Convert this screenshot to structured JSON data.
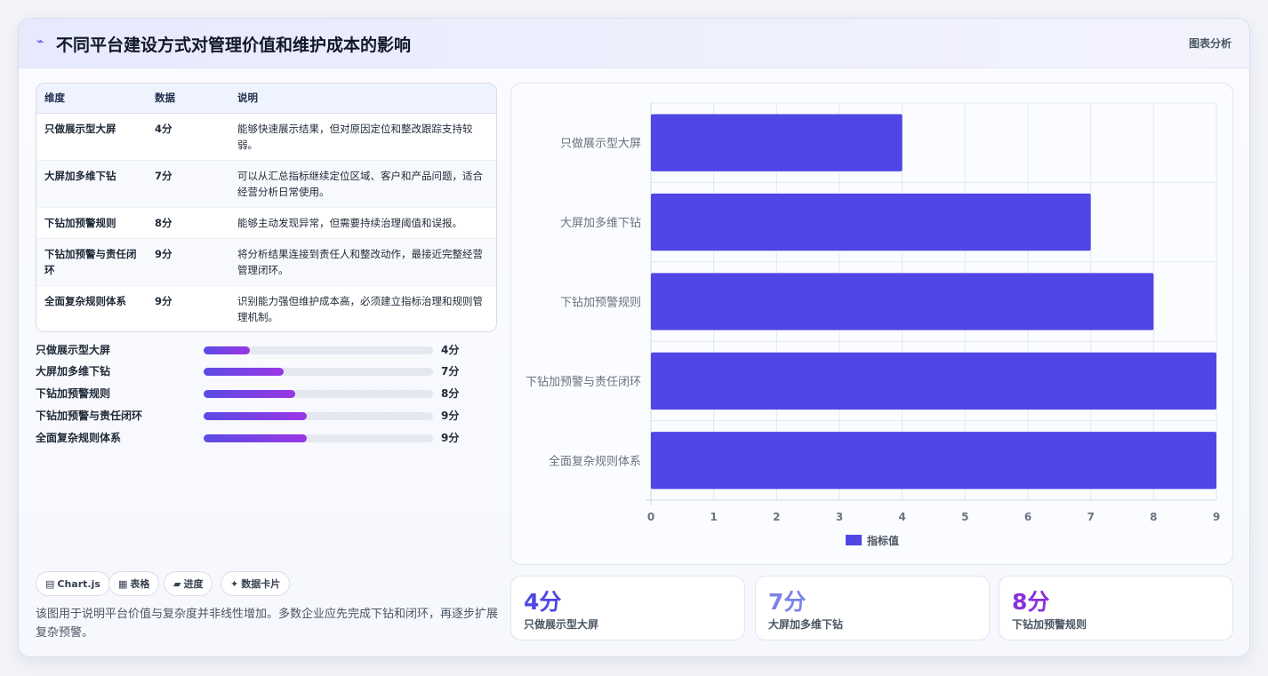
{
  "header": {
    "logo_icon": "pulse-icon",
    "logo_glyph": "⌁",
    "title": "不同平台建设方式对管理价值和维护成本的影响",
    "tag": "图表分析"
  },
  "table": {
    "headers": [
      "维度",
      "数据",
      "说明"
    ],
    "rows": [
      [
        "只做展示型大屏",
        "4分",
        "能够快速展示结果，但对原因定位和整改跟踪支持较弱。"
      ],
      [
        "大屏加多维下钻",
        "7分",
        "可以从汇总指标继续定位区域、客户和产品问题，适合经营分析日常使用。"
      ],
      [
        "下钻加预警规则",
        "8分",
        "能够主动发现异常，但需要持续治理阈值和误报。"
      ],
      [
        "下钻加预警与责任闭环",
        "9分",
        "将分析结果连接到责任人和整改动作，最接近完整经营管理闭环。"
      ],
      [
        "全面复杂规则体系",
        "9分",
        "识别能力强但维护成本高，必须建立指标治理和规则管理机制。"
      ]
    ]
  },
  "progress": [
    {
      "label": "只做展示型大屏",
      "value": 4,
      "display": "4分"
    },
    {
      "label": "大屏加多维下钻",
      "value": 7,
      "display": "7分"
    },
    {
      "label": "下钻加预警规则",
      "value": 8,
      "display": "8分"
    },
    {
      "label": "下钻加预警与责任闭环",
      "value": 9,
      "display": "9分"
    },
    {
      "label": "全面复杂规则体系",
      "value": 9,
      "display": "9分"
    }
  ],
  "progress_max": 20,
  "chips": [
    {
      "icon": "chart-icon",
      "glyph": "▤",
      "label": "Chart.js"
    },
    {
      "icon": "table-icon",
      "glyph": "▦",
      "label": "表格"
    },
    {
      "icon": "folder-icon",
      "glyph": "▰",
      "label": "进度"
    },
    {
      "icon": "sparkle-icon",
      "glyph": "✦",
      "label": "数据卡片"
    }
  ],
  "note": "该图用于说明平台价值与复杂度并非线性增加。多数企业应先完成下钻和闭环，再逐步扩展复杂预警。",
  "stats": [
    {
      "value": "4分",
      "label": "只做展示型大屏",
      "color": "#4f46e5"
    },
    {
      "value": "7分",
      "label": "大屏加多维下钻",
      "color": "#7c83e8"
    },
    {
      "value": "8分",
      "label": "下钻加预警规则",
      "color": "#8b2fd6"
    }
  ],
  "chart_data": {
    "type": "bar",
    "orientation": "horizontal",
    "categories": [
      "只做展示型大屏",
      "大屏加多维下钻",
      "下钻加预警规则",
      "下钻加预警与责任闭环",
      "全面复杂规则体系"
    ],
    "series": [
      {
        "name": "指标值",
        "values": [
          4,
          7,
          8,
          9,
          9
        ],
        "color": "#4f46e5"
      }
    ],
    "xlim": [
      0,
      9
    ],
    "xticks": [
      0,
      1,
      2,
      3,
      4,
      5,
      6,
      7,
      8,
      9
    ],
    "grid": true,
    "legend_position": "bottom"
  }
}
